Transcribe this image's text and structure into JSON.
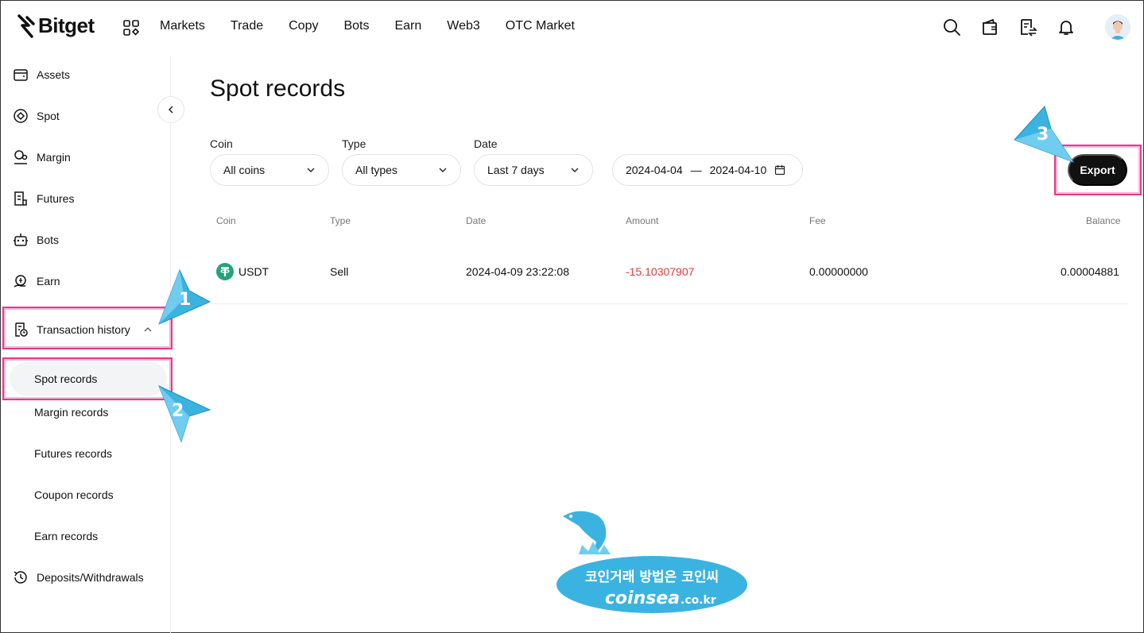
{
  "brand": {
    "name": "Bitget"
  },
  "nav": {
    "items": [
      "Markets",
      "Trade",
      "Copy",
      "Bots",
      "Earn",
      "Web3",
      "OTC Market"
    ],
    "icons": [
      "search-icon",
      "wallet-icon",
      "orders-icon",
      "bell-icon"
    ]
  },
  "sidebar": {
    "items": [
      {
        "label": "Assets",
        "icon": "wallet-icon"
      },
      {
        "label": "Spot",
        "icon": "spot-icon"
      },
      {
        "label": "Margin",
        "icon": "margin-icon"
      },
      {
        "label": "Futures",
        "icon": "futures-icon"
      },
      {
        "label": "Bots",
        "icon": "bot-icon"
      },
      {
        "label": "Earn",
        "icon": "earn-icon"
      },
      {
        "label": "Transaction history",
        "icon": "history-doc-icon"
      }
    ],
    "sub_items": [
      "Spot records",
      "Margin records",
      "Futures records",
      "Coupon records",
      "Earn records"
    ],
    "deposits": "Deposits/Withdrawals"
  },
  "main": {
    "title": "Spot records",
    "filters": {
      "coin_label": "Coin",
      "coin_value": "All coins",
      "type_label": "Type",
      "type_value": "All types",
      "date_label": "Date",
      "date_value": "Last 7 days",
      "date_start": "2024-04-04",
      "date_sep": "—",
      "date_end": "2024-04-10"
    },
    "export_label": "Export",
    "table": {
      "headers": [
        "Coin",
        "Type",
        "Date",
        "Amount",
        "Fee",
        "Balance"
      ],
      "rows": [
        {
          "coin": "USDT",
          "type": "Sell",
          "date": "2024-04-09 23:22:08",
          "amount": "-15.10307907",
          "fee": "0.00000000",
          "balance": "0.00004881"
        }
      ]
    }
  },
  "annotations": {
    "steps": [
      "1",
      "2",
      "3"
    ]
  },
  "watermark": {
    "line1": "코인거래 방법은 코인씨",
    "line2": "coinsea",
    "line2_suffix": ".co.kr"
  },
  "colors": {
    "accent_pink": "#e6398f",
    "callout_blue": "#3bb3e0",
    "negative": "#e23b3b",
    "usdt_green": "#26a17b"
  }
}
